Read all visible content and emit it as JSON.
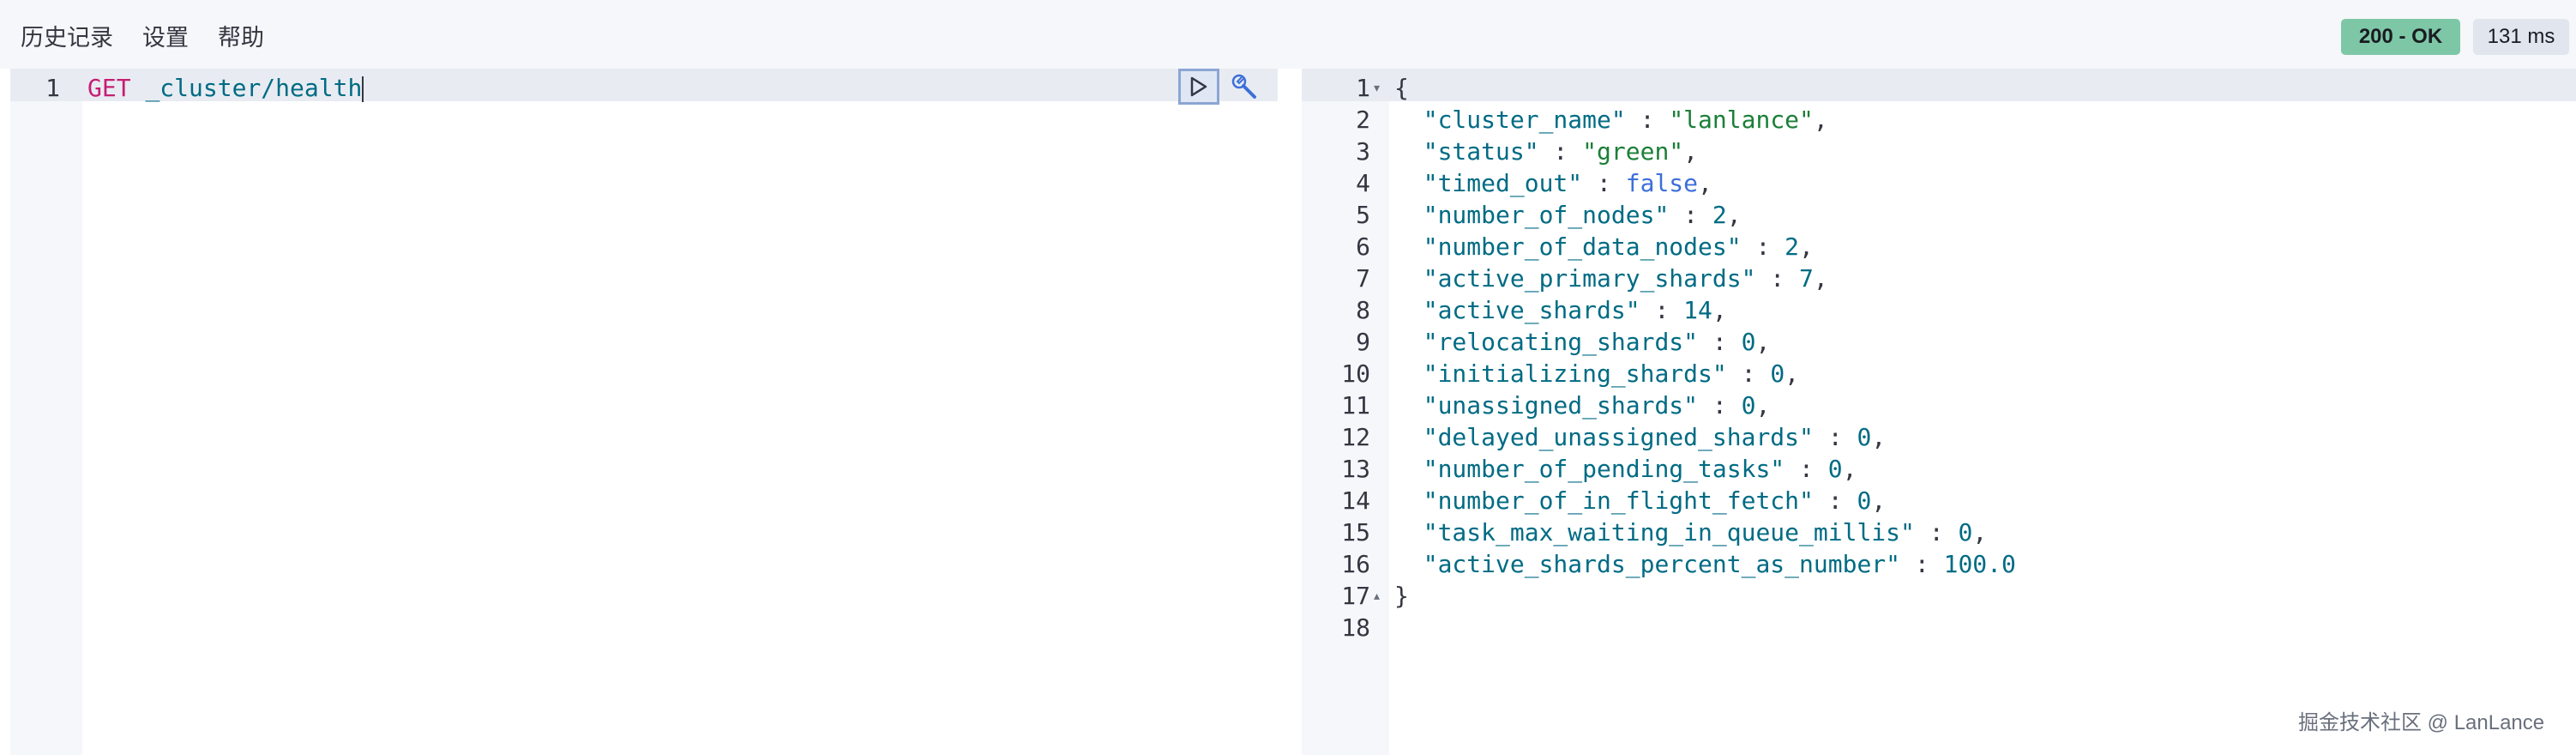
{
  "menu": [
    "历史记录",
    "设置",
    "帮助"
  ],
  "status": "200 - OK",
  "timing": "131 ms",
  "request": {
    "line_number": "1",
    "method": "GET",
    "path": "_cluster/health"
  },
  "response": {
    "line_numbers": [
      "1",
      "2",
      "3",
      "4",
      "5",
      "6",
      "7",
      "8",
      "9",
      "10",
      "11",
      "12",
      "13",
      "14",
      "15",
      "16",
      "17",
      "18"
    ],
    "open_brace": "{",
    "close_brace": "}",
    "fields": [
      {
        "key": "\"cluster_name\"",
        "value": "\"lanlance\"",
        "type": "str",
        "comma": ","
      },
      {
        "key": "\"status\"",
        "value": "\"green\"",
        "type": "str",
        "comma": ","
      },
      {
        "key": "\"timed_out\"",
        "value": "false",
        "type": "bool",
        "comma": ","
      },
      {
        "key": "\"number_of_nodes\"",
        "value": "2",
        "type": "num",
        "comma": ","
      },
      {
        "key": "\"number_of_data_nodes\"",
        "value": "2",
        "type": "num",
        "comma": ","
      },
      {
        "key": "\"active_primary_shards\"",
        "value": "7",
        "type": "num",
        "comma": ","
      },
      {
        "key": "\"active_shards\"",
        "value": "14",
        "type": "num",
        "comma": ","
      },
      {
        "key": "\"relocating_shards\"",
        "value": "0",
        "type": "num",
        "comma": ","
      },
      {
        "key": "\"initializing_shards\"",
        "value": "0",
        "type": "num",
        "comma": ","
      },
      {
        "key": "\"unassigned_shards\"",
        "value": "0",
        "type": "num",
        "comma": ","
      },
      {
        "key": "\"delayed_unassigned_shards\"",
        "value": "0",
        "type": "num",
        "comma": ","
      },
      {
        "key": "\"number_of_pending_tasks\"",
        "value": "0",
        "type": "num",
        "comma": ","
      },
      {
        "key": "\"number_of_in_flight_fetch\"",
        "value": "0",
        "type": "num",
        "comma": ","
      },
      {
        "key": "\"task_max_waiting_in_queue_millis\"",
        "value": "0",
        "type": "num",
        "comma": ","
      },
      {
        "key": "\"active_shards_percent_as_number\"",
        "value": "100.0",
        "type": "num",
        "comma": ""
      }
    ]
  },
  "watermark": "掘金技术社区 @ LanLance"
}
